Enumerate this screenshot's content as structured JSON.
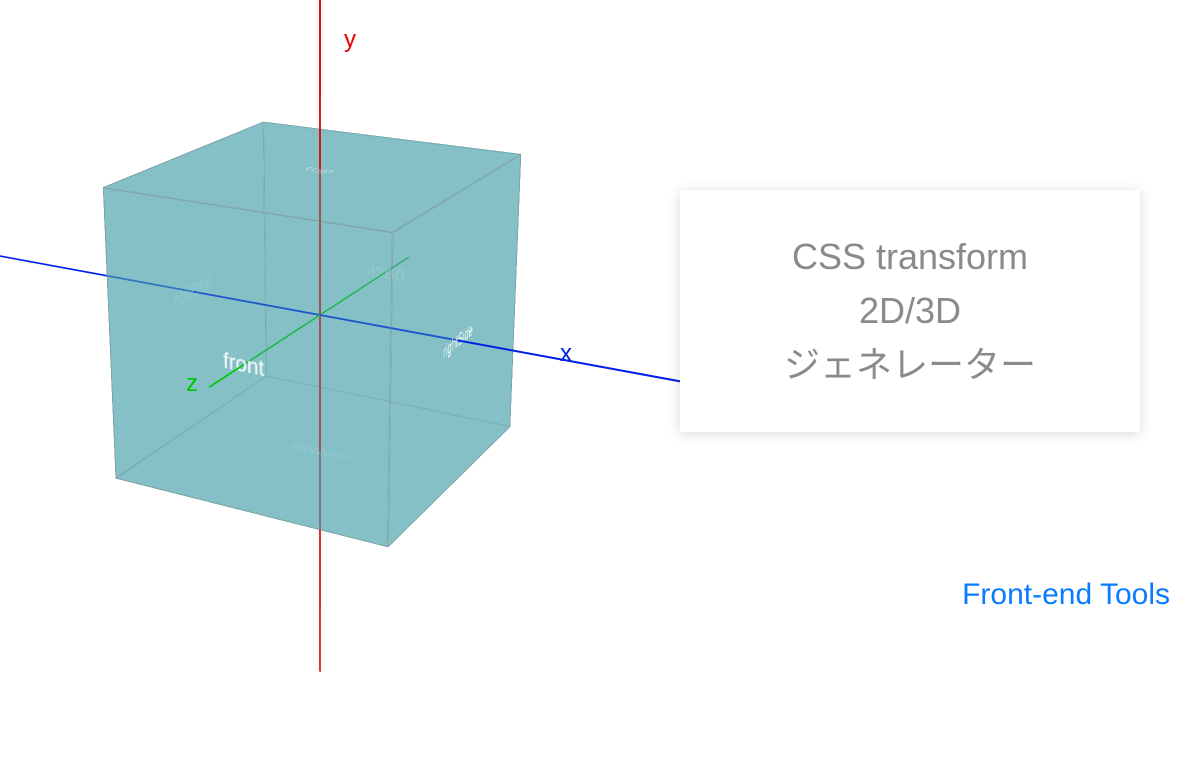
{
  "axes": {
    "x": "x",
    "y": "y",
    "z": "z"
  },
  "cube": {
    "front": "front",
    "back": "back",
    "left": "leftSide",
    "right": "rightSide",
    "top": "top",
    "bottom": "bottom"
  },
  "card": {
    "line1": "CSS transform",
    "line2": "2D/3D",
    "line3": "ジェネレーター"
  },
  "brand": "Front-end Tools"
}
